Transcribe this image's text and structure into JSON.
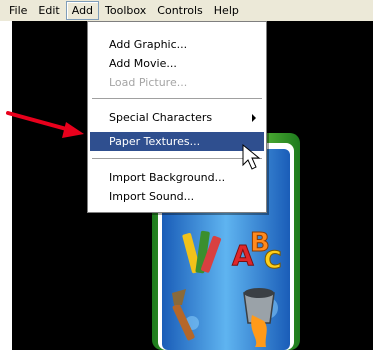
{
  "menubar": {
    "items": [
      "File",
      "Edit",
      "Add",
      "Toolbox",
      "Controls",
      "Help"
    ],
    "open_item": "Add"
  },
  "menu": {
    "add_graphic": "Add Graphic...",
    "add_movie": "Add Movie...",
    "load_picture": "Load Picture...",
    "special_characters": "Special Characters",
    "paper_textures": "Paper Textures...",
    "import_background": "Import Background...",
    "import_sound": "Import Sound..."
  },
  "colors": {
    "highlight": "#2f4f8f",
    "annotation_arrow": "#e8001c",
    "canvas": "#000000"
  },
  "icons": [
    "submenu-arrow-icon",
    "mouse-pointer-icon",
    "red-annotation-arrow",
    "crayon-icon",
    "alphabet-blocks-icon",
    "paintbrush-icon",
    "paint-bucket-icon"
  ]
}
